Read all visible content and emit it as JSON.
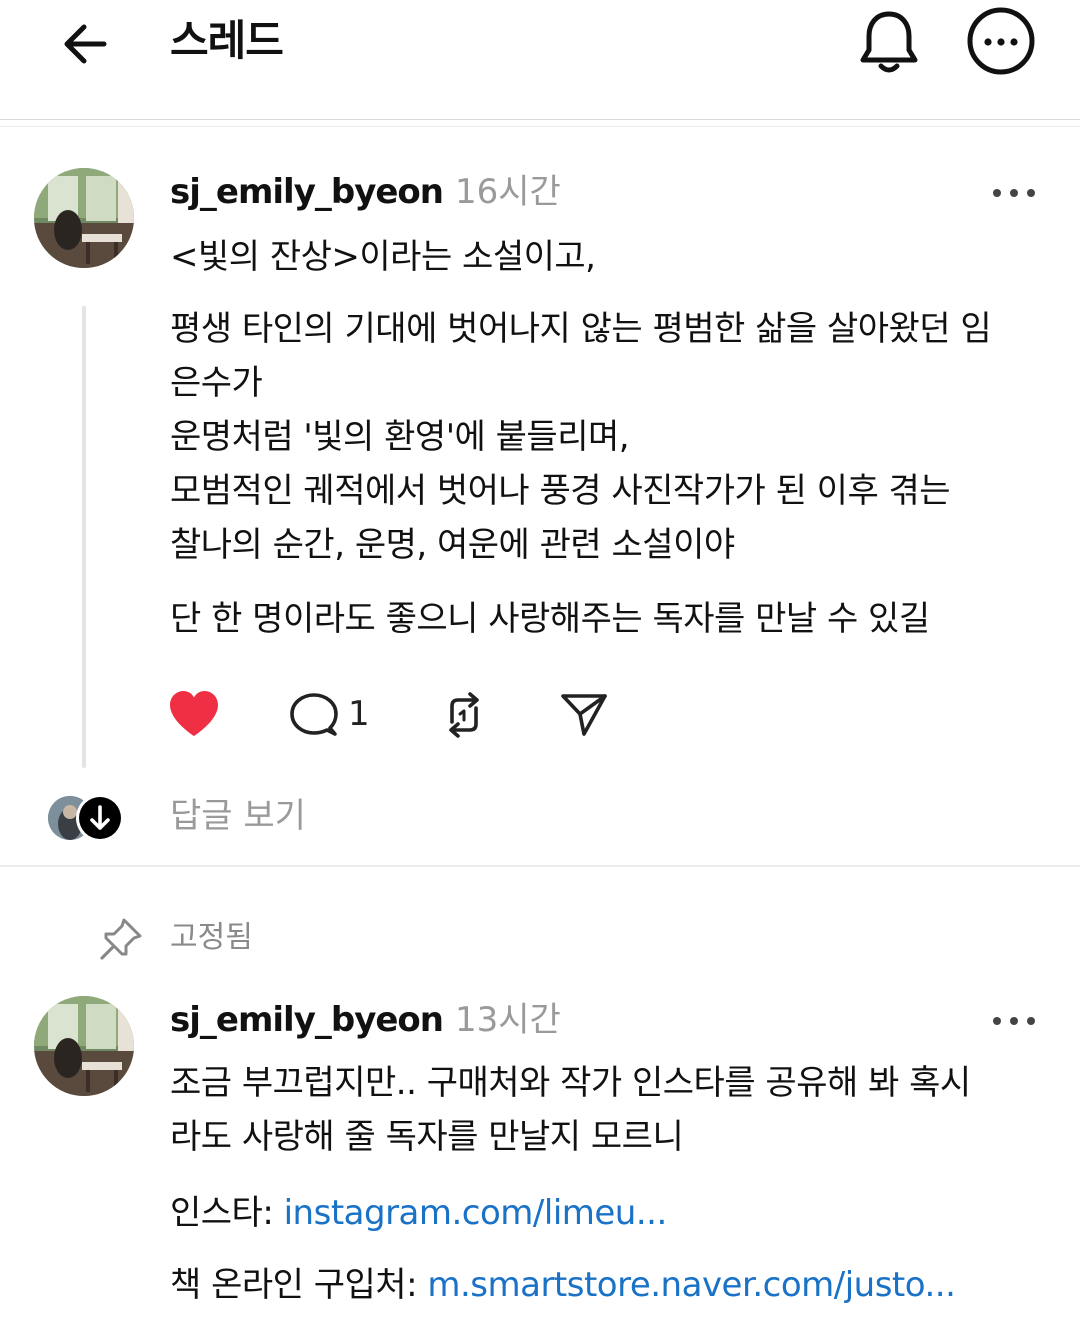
{
  "header": {
    "title": "스레드"
  },
  "posts": [
    {
      "username": "sj_emily_byeon",
      "time": "16시간",
      "lines": [
        "<빛의 잔상>이라는 소설이고,",
        "평생 타인의 기대에 벗어나지 않는 평범한 삶을 살아왔던 임",
        "은수가",
        "운명처럼 '빛의 환영'에 붙들리며,",
        "모범적인 궤적에서 벗어나 풍경 사진작가가 된 이후 겪는",
        "찰나의 순간, 운명, 여운에 관련 소설이야",
        "단 한 명이라도 좋으니 사랑해주는 독자를 만날 수 있길"
      ],
      "comment_count": "1",
      "view_replies": "답글 보기"
    },
    {
      "pinned_label": "고정됨",
      "username": "sj_emily_byeon",
      "time": "13시간",
      "lines": [
        "조금 부끄럽지만.. 구매처와 작가 인스타를 공유해 봐  혹시",
        "라도 사랑해 줄 독자를 만날지 모르니"
      ],
      "insta_label": "인스타: ",
      "insta_link": "instagram.com/limeu...",
      "store_label": "책 온라인 구입처: ",
      "store_link": "m.smartstore.naver.com/justo..."
    }
  ],
  "icons": {
    "back": "arrow-left-icon",
    "bell": "bell-icon",
    "more": "more-circle-icon",
    "heart": "heart-icon",
    "comment": "comment-icon",
    "repost": "repost-icon",
    "share": "send-icon",
    "pin": "pin-icon"
  },
  "colors": {
    "like": "#ef3044",
    "link": "#1a72c7",
    "muted": "#9a9a9a"
  }
}
